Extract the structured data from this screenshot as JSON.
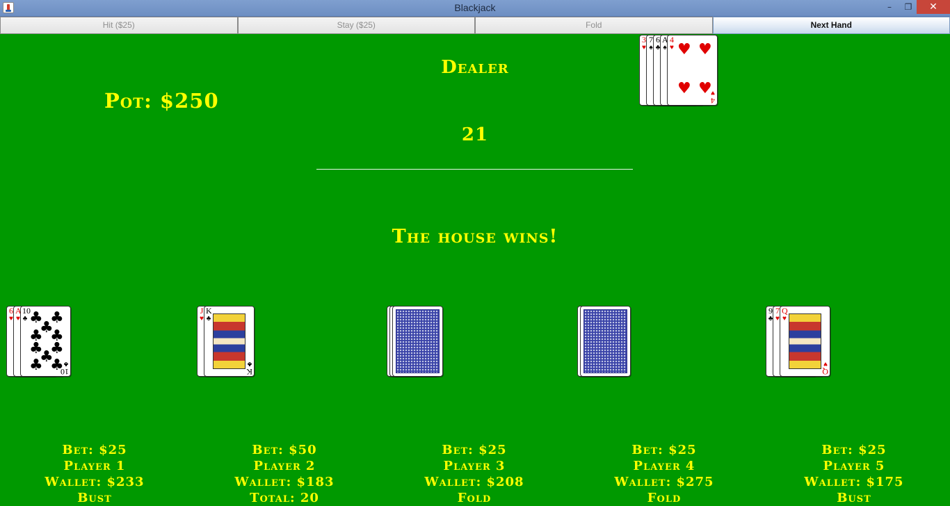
{
  "window": {
    "title": "Blackjack"
  },
  "toolbar": {
    "hit": "Hit ($25)",
    "stay": "Stay ($25)",
    "fold": "Fold",
    "next_hand": "Next Hand"
  },
  "table": {
    "pot": "Pot: $250",
    "dealer_label": "Dealer",
    "dealer_total": "21",
    "result": "The house wins!"
  },
  "dealer_hand": [
    {
      "rank": "3",
      "suit": "♥",
      "color": "red"
    },
    {
      "rank": "7",
      "suit": "♠",
      "color": "black"
    },
    {
      "rank": "6",
      "suit": "♣",
      "color": "black"
    },
    {
      "rank": "A",
      "suit": "♠",
      "color": "black"
    },
    {
      "rank": "4",
      "suit": "♥",
      "color": "red"
    }
  ],
  "players": [
    {
      "bet": "Bet: $25",
      "name": "Player 1",
      "wallet": "Wallet: $233",
      "status": "Bust",
      "cards": [
        {
          "rank": "6",
          "suit": "♥",
          "color": "red"
        },
        {
          "rank": "A",
          "suit": "♥",
          "color": "red"
        },
        {
          "rank": "10",
          "suit": "♣",
          "color": "black"
        }
      ]
    },
    {
      "bet": "Bet: $50",
      "name": "Player 2",
      "wallet": "Wallet: $183",
      "status": "Total: 20",
      "cards": [
        {
          "rank": "J",
          "suit": "♥",
          "color": "red"
        },
        {
          "rank": "K",
          "suit": "♣",
          "color": "black"
        }
      ]
    },
    {
      "bet": "Bet: $25",
      "name": "Player 3",
      "wallet": "Wallet: $208",
      "status": "Fold",
      "cards": [
        {
          "face": "down"
        },
        {
          "face": "down"
        },
        {
          "face": "down"
        }
      ]
    },
    {
      "bet": "Bet: $25",
      "name": "Player 4",
      "wallet": "Wallet: $275",
      "status": "Fold",
      "cards": [
        {
          "face": "down"
        },
        {
          "face": "down"
        }
      ]
    },
    {
      "bet": "Bet: $25",
      "name": "Player 5",
      "wallet": "Wallet: $175",
      "status": "Bust",
      "cards": [
        {
          "rank": "9",
          "suit": "♣",
          "color": "black"
        },
        {
          "rank": "7",
          "suit": "♥",
          "color": "red"
        },
        {
          "rank": "Q",
          "suit": "♥",
          "color": "red"
        }
      ]
    }
  ],
  "colors": {
    "felt": "#009900",
    "text": "#ffff00"
  }
}
